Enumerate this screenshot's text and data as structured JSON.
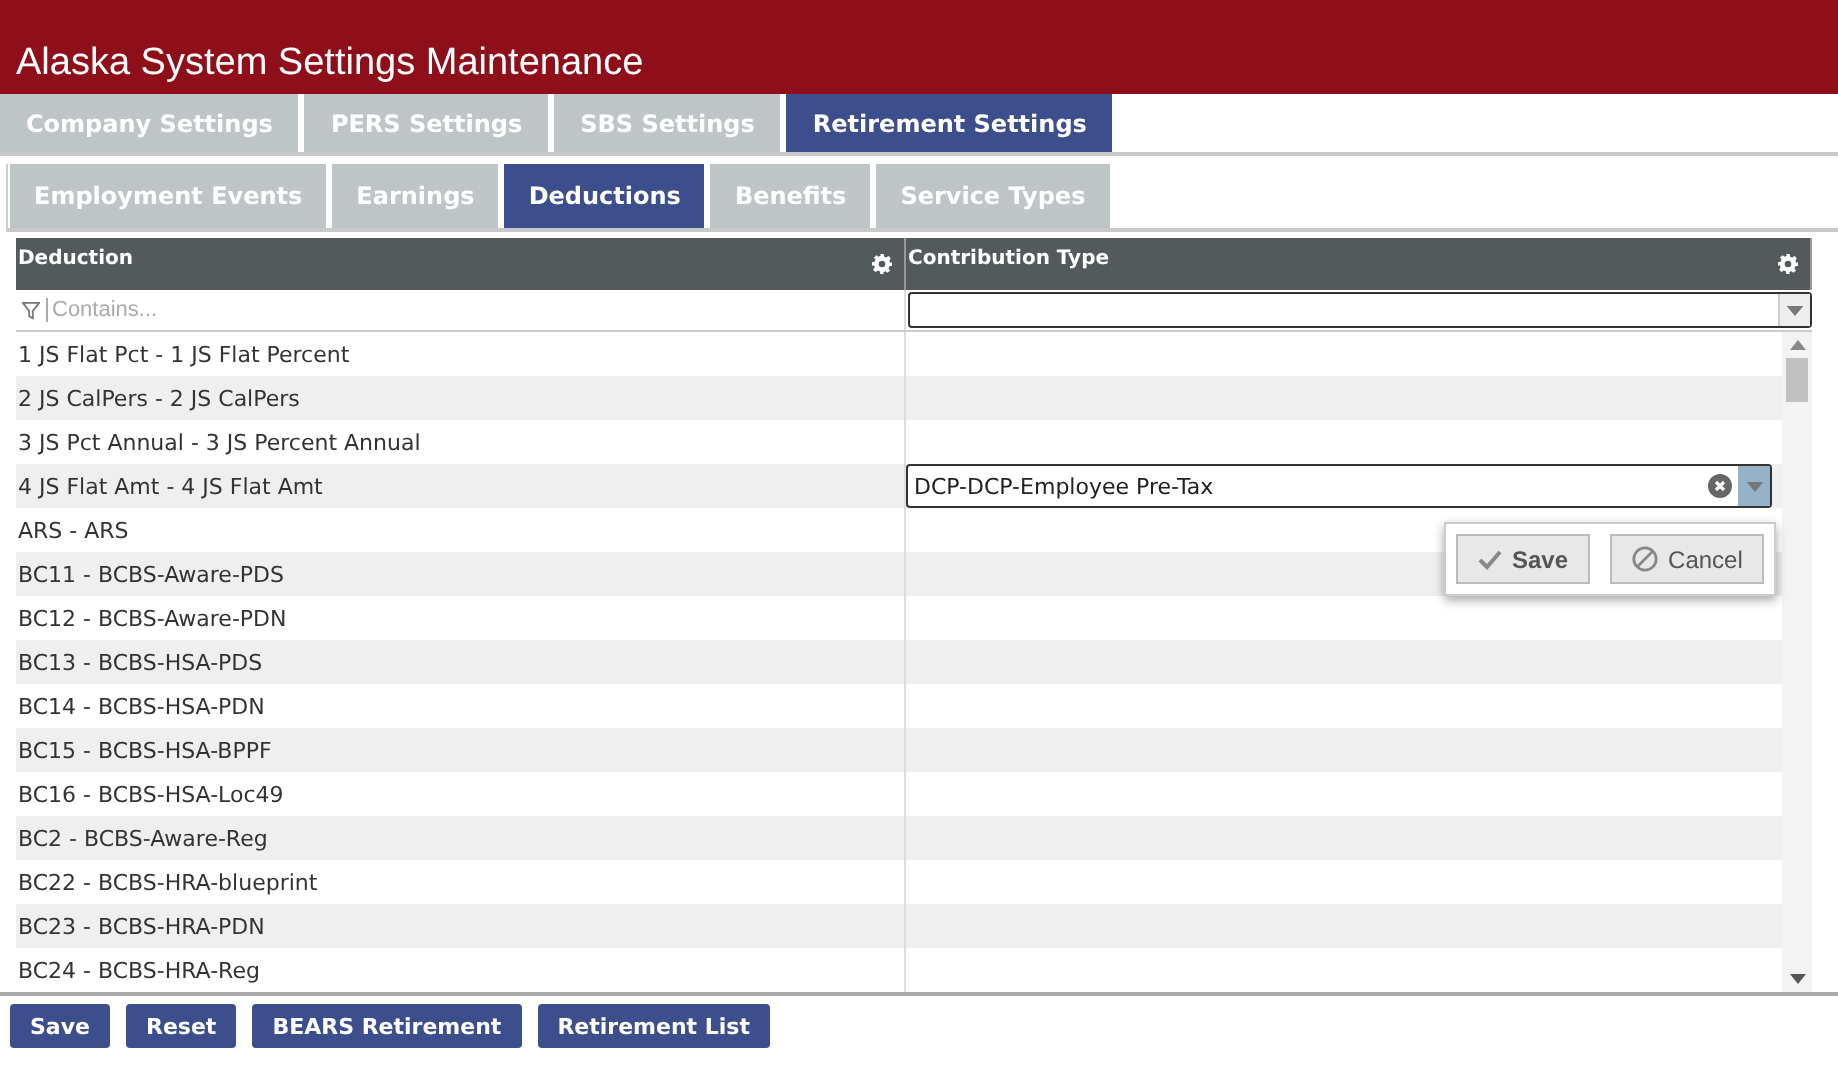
{
  "window": {
    "title": "Alaska System Settings Maintenance"
  },
  "tabs": [
    {
      "label": "Company Settings",
      "selected": false
    },
    {
      "label": "PERS Settings",
      "selected": false
    },
    {
      "label": "SBS Settings",
      "selected": false
    },
    {
      "label": "Retirement Settings",
      "selected": true
    }
  ],
  "subtabs": [
    {
      "label": "Employment Events",
      "selected": false
    },
    {
      "label": "Earnings",
      "selected": false
    },
    {
      "label": "Deductions",
      "selected": true
    },
    {
      "label": "Benefits",
      "selected": false
    },
    {
      "label": "Service Types",
      "selected": false
    }
  ],
  "table": {
    "columns": [
      "Deduction",
      "Contribution Type"
    ],
    "filter": {
      "placeholder": "Contains..."
    },
    "rows": [
      {
        "deduction": "1 JS Flat Pct - 1 JS Flat Percent"
      },
      {
        "deduction": "2 JS CalPers - 2 JS CalPers"
      },
      {
        "deduction": "3 JS Pct Annual - 3 JS Percent Annual"
      },
      {
        "deduction": "4 JS Flat Amt - 4 JS Flat Amt",
        "editing": true,
        "contribution_type": "DCP-DCP-Employee Pre-Tax"
      },
      {
        "deduction": "ARS - ARS"
      },
      {
        "deduction": "BC11 - BCBS-Aware-PDS"
      },
      {
        "deduction": "BC12 - BCBS-Aware-PDN"
      },
      {
        "deduction": "BC13 - BCBS-HSA-PDS"
      },
      {
        "deduction": "BC14 - BCBS-HSA-PDN"
      },
      {
        "deduction": "BC15 - BCBS-HSA-BPPF"
      },
      {
        "deduction": "BC16 - BCBS-HSA-Loc49"
      },
      {
        "deduction": "BC2 - BCBS-Aware-Reg"
      },
      {
        "deduction": "BC22 - BCBS-HRA-blueprint"
      },
      {
        "deduction": "BC23 - BCBS-HRA-PDN"
      },
      {
        "deduction": "BC24 - BCBS-HRA-Reg"
      }
    ],
    "edit_popup": {
      "save": "Save",
      "cancel": "Cancel"
    }
  },
  "buttons": [
    "Save",
    "Reset",
    "BEARS Retirement",
    "Retirement List"
  ]
}
